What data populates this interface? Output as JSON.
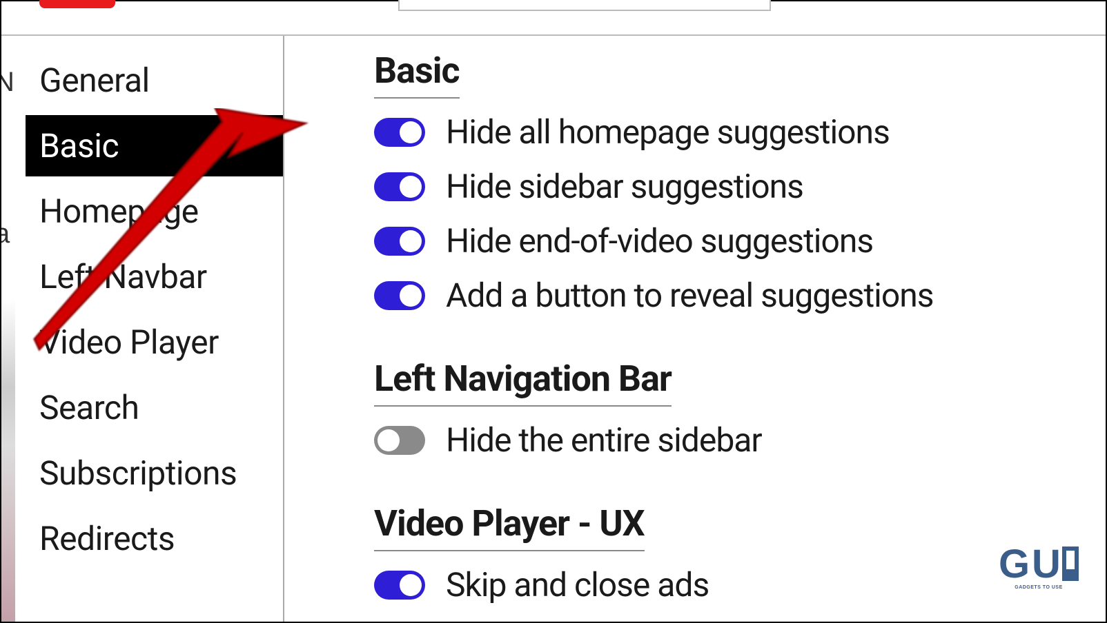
{
  "sidebar": {
    "items": [
      {
        "label": "General",
        "active": false
      },
      {
        "label": "Basic",
        "active": true
      },
      {
        "label": "Homepage",
        "active": false
      },
      {
        "label": "Left Navbar",
        "active": false
      },
      {
        "label": "Video Player",
        "active": false
      },
      {
        "label": "Search",
        "active": false
      },
      {
        "label": "Subscriptions",
        "active": false
      },
      {
        "label": "Redirects",
        "active": false
      }
    ]
  },
  "sections": {
    "basic": {
      "title": "Basic",
      "toggles": [
        {
          "label": "Hide all homepage suggestions",
          "on": true
        },
        {
          "label": "Hide sidebar suggestions",
          "on": true
        },
        {
          "label": "Hide end-of-video suggestions",
          "on": true
        },
        {
          "label": "Add a button to reveal suggestions",
          "on": true
        }
      ]
    },
    "leftnav": {
      "title": "Left Navigation Bar",
      "toggles": [
        {
          "label": "Hide the entire sidebar",
          "on": false
        }
      ]
    },
    "videoplayer": {
      "title": "Video Player - UX",
      "toggles": [
        {
          "label": "Skip and close ads",
          "on": true
        }
      ]
    }
  },
  "watermark": {
    "logo": "GU",
    "tagline": "GADGETS TO USE"
  }
}
